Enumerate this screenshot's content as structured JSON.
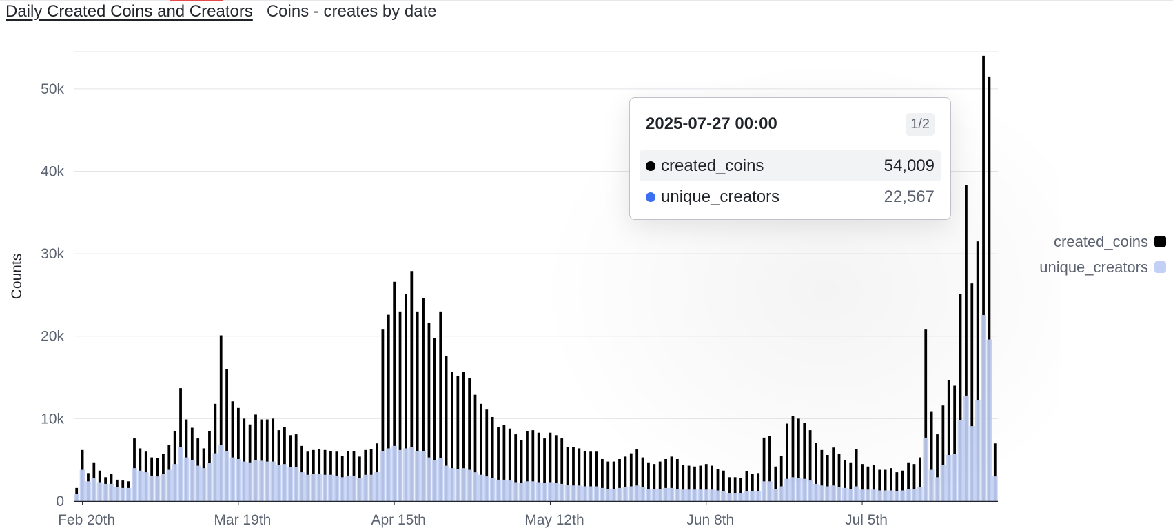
{
  "header": {
    "title": "Daily Created Coins and Creators",
    "subtitle": "Coins - creates by date"
  },
  "colors": {
    "created_coins": "#000000",
    "unique_creators": "#c2d0f5",
    "tooltip_unique_creators_dot": "#3b6ff2"
  },
  "chart_data": {
    "type": "bar",
    "ylabel": "Counts",
    "ylim": [
      0,
      54500
    ],
    "y_ticks": [
      0,
      10000,
      20000,
      30000,
      40000,
      50000
    ],
    "y_tick_labels": [
      "0",
      "10k",
      "20k",
      "30k",
      "40k",
      "50k"
    ],
    "x_start": "2025-02-19",
    "x_ticks": [
      "2025-02-20",
      "2025-03-19",
      "2025-04-15",
      "2025-05-12",
      "2025-06-08",
      "2025-07-05"
    ],
    "x_tick_labels": [
      "Feb 20th",
      "Mar 19th",
      "Apr 15th",
      "May 12th",
      "Jun 8th",
      "Jul 5th"
    ],
    "grid": true,
    "legend_position": "right",
    "series": [
      {
        "name": "created_coins",
        "values": [
          1600,
          6200,
          3400,
          4700,
          3700,
          2900,
          3300,
          2600,
          2500,
          2400,
          7600,
          6400,
          6000,
          5300,
          5200,
          5700,
          6800,
          8500,
          13700,
          9900,
          8900,
          7600,
          6400,
          8500,
          11800,
          20100,
          16000,
          12100,
          11300,
          10000,
          9300,
          10500,
          9900,
          9900,
          10000,
          8600,
          9000,
          8000,
          8100,
          6700,
          6000,
          6200,
          6300,
          6200,
          6100,
          6000,
          5500,
          6100,
          6100,
          5400,
          6200,
          6300,
          7000,
          20800,
          22600,
          26600,
          23000,
          25100,
          27900,
          23000,
          24600,
          21600,
          19800,
          23000,
          17600,
          15700,
          15200,
          15700,
          14900,
          12900,
          11800,
          11100,
          10200,
          9000,
          9200,
          8800,
          8100,
          7400,
          8500,
          8600,
          8300,
          7600,
          8300,
          8000,
          7600,
          6600,
          6600,
          6400,
          6100,
          6000,
          6000,
          5100,
          4800,
          4800,
          5100,
          5400,
          5800,
          6300,
          5300,
          4700,
          4500,
          4800,
          5100,
          5400,
          5100,
          4400,
          4300,
          4200,
          4300,
          4500,
          4300,
          3900,
          3700,
          2900,
          2900,
          2800,
          3600,
          3300,
          3400,
          7700,
          7900,
          4200,
          5500,
          9400,
          10300,
          10000,
          9500,
          8600,
          7100,
          6200,
          5600,
          6500,
          5700,
          5000,
          4700,
          6300,
          4500,
          4200,
          4400,
          3800,
          3800,
          4000,
          3500,
          3700,
          4700,
          4500,
          5300,
          20800,
          10900,
          8100,
          11600,
          14700,
          14000,
          25100,
          38300,
          26400,
          31500,
          54009,
          51500,
          7000
        ],
        "overlay": [
          {
            "date": "2025-07-27",
            "value": 54009
          }
        ]
      },
      {
        "name": "unique_creators",
        "values": [
          900,
          3800,
          2400,
          2800,
          2300,
          2100,
          2100,
          1700,
          1600,
          1600,
          4000,
          3700,
          3500,
          3100,
          3000,
          3300,
          3800,
          4500,
          6600,
          5300,
          5000,
          4300,
          4000,
          4600,
          5800,
          6800,
          6100,
          5300,
          5100,
          4800,
          4700,
          5000,
          4900,
          4800,
          4800,
          4400,
          4500,
          4100,
          4100,
          3500,
          3200,
          3300,
          3300,
          3200,
          3200,
          3100,
          2900,
          3100,
          3100,
          2800,
          3200,
          3200,
          3500,
          6100,
          6400,
          6700,
          6200,
          6400,
          6600,
          6100,
          6100,
          5300,
          5000,
          5200,
          4300,
          4000,
          3900,
          4000,
          3800,
          3500,
          3200,
          3000,
          2800,
          2600,
          2600,
          2500,
          2300,
          2200,
          2400,
          2400,
          2300,
          2200,
          2300,
          2200,
          2100,
          2000,
          1900,
          1900,
          1800,
          1800,
          1800,
          1600,
          1500,
          1500,
          1600,
          1700,
          1800,
          1900,
          1700,
          1500,
          1500,
          1500,
          1600,
          1600,
          1500,
          1400,
          1400,
          1400,
          1400,
          1400,
          1400,
          1300,
          1200,
          1000,
          1000,
          1000,
          1200,
          1200,
          1200,
          2400,
          2400,
          1500,
          1800,
          2700,
          2900,
          2800,
          2700,
          2500,
          2100,
          1900,
          1800,
          1900,
          1700,
          1600,
          1500,
          1800,
          1400,
          1400,
          1400,
          1300,
          1300,
          1300,
          1200,
          1300,
          1500,
          1500,
          1700,
          7700,
          3800,
          2900,
          4400,
          5600,
          5700,
          9800,
          12800,
          9100,
          12200,
          22567,
          19600,
          3000
        ]
      }
    ]
  },
  "tooltip": {
    "date": "2025-07-27 00:00",
    "page": "1/2",
    "rows": [
      {
        "name": "created_coins",
        "value": "54,009"
      },
      {
        "name": "unique_creators",
        "value": "22,567"
      }
    ]
  },
  "legend": {
    "items": [
      {
        "label": "created_coins"
      },
      {
        "label": "unique_creators"
      }
    ]
  }
}
